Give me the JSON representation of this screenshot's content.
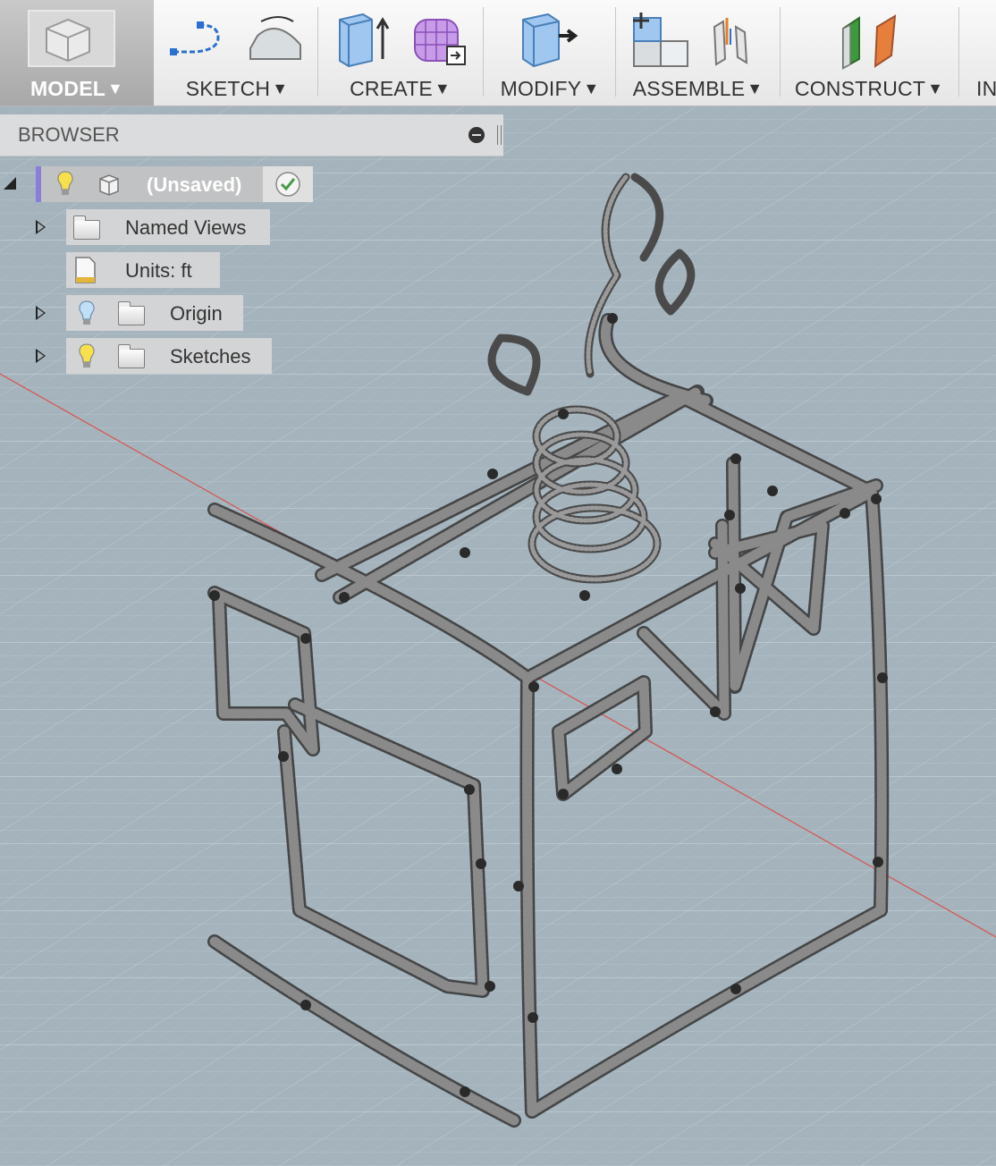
{
  "toolbar": {
    "groups": [
      {
        "label": "MODEL",
        "icon": "model-workspace-icon",
        "active": true
      },
      {
        "label": "SKETCH",
        "icon": "sketch-icon"
      },
      {
        "label": "CREATE",
        "icon": "create-icon"
      },
      {
        "label": "MODIFY",
        "icon": "modify-icon"
      },
      {
        "label": "ASSEMBLE",
        "icon": "assemble-icon"
      },
      {
        "label": "CONSTRUCT",
        "icon": "construct-icon"
      },
      {
        "label": "IN",
        "icon": ""
      }
    ],
    "caret": "▼"
  },
  "browser": {
    "title": "BROWSER",
    "root": {
      "label": "(Unsaved)",
      "status_icon": "checkmark-icon"
    },
    "items": [
      {
        "label": "Named Views",
        "icon": "folder-icon",
        "expandable": true
      },
      {
        "label": "Units: ft",
        "icon": "units-document-icon",
        "expandable": false
      },
      {
        "label": "Origin",
        "icon": "folder-icon",
        "expandable": true,
        "bulb": "bulb-off-icon"
      },
      {
        "label": "Sketches",
        "icon": "folder-icon",
        "expandable": true,
        "bulb": "bulb-on-icon"
      }
    ]
  },
  "colors": {
    "viewport_bg": "#a4b3bc",
    "grid_line": "#b8c5cd",
    "axis_red": "#d9534f",
    "toolbar_active": "#b5b5b5",
    "tube": "#6e6e6e"
  }
}
